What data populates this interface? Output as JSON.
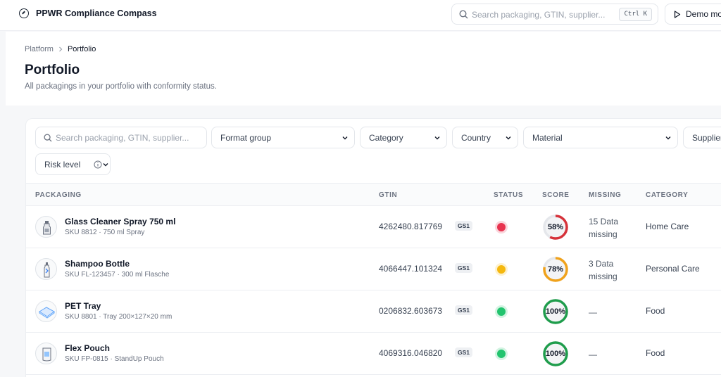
{
  "app": {
    "title": "PPWR Compliance Compass"
  },
  "search": {
    "placeholder": "Search packaging, GTIN, supplier...",
    "shortcut": "Ctrl K"
  },
  "demo_button": {
    "label": "Demo mo"
  },
  "breadcrumb": {
    "root": "Platform",
    "current": "Portfolio"
  },
  "page": {
    "title": "Portfolio",
    "subtitle": "All packagings in your portfolio with conformity status."
  },
  "filters": {
    "search_placeholder": "Search packaging, GTIN, supplier...",
    "format_group": "Format group",
    "category": "Category",
    "country": "Country",
    "material": "Material",
    "supplier": "Supplier",
    "risk_level": "Risk level"
  },
  "table": {
    "columns": {
      "packaging": "PACKAGING",
      "gtin": "GTIN",
      "status": "STATUS",
      "score": "SCORE",
      "missing": "MISSING",
      "category": "CATEGORY"
    },
    "gs1_badge": "GS1",
    "rows": [
      {
        "name": "Glass Cleaner Spray 750 ml",
        "sku": "SKU 8812 · 750 ml Spray",
        "gtin": "4262480.817769",
        "status_color": "#e8334f",
        "score": 58,
        "score_label": "58%",
        "score_color": "#d6323a",
        "missing_line1": "15 Data",
        "missing_line2": "missing",
        "category": "Home Care",
        "thumb": "spray-bottle"
      },
      {
        "name": "Shampoo Bottle",
        "sku": "SKU FL-123457 · 300 ml Flasche",
        "gtin": "4066447.101324",
        "status_color": "#f5b80f",
        "score": 78,
        "score_label": "78%",
        "score_color": "#f0a21b",
        "missing_line1": "3 Data",
        "missing_line2": "missing",
        "category": "Personal Care",
        "thumb": "shampoo-bottle"
      },
      {
        "name": "PET Tray",
        "sku": "SKU 8801 · Tray 200×127×20 mm",
        "gtin": "0206832.603673",
        "status_color": "#22c46e",
        "score": 100,
        "score_label": "100%",
        "score_color": "#1f9d4c",
        "missing_line1": "—",
        "missing_line2": "",
        "category": "Food",
        "thumb": "pet-tray"
      },
      {
        "name": "Flex Pouch",
        "sku": "SKU FP-0815 · StandUp Pouch",
        "gtin": "4069316.046820",
        "status_color": "#22c46e",
        "score": 100,
        "score_label": "100%",
        "score_color": "#1f9d4c",
        "missing_line1": "—",
        "missing_line2": "",
        "category": "Food",
        "thumb": "flex-pouch"
      }
    ]
  }
}
